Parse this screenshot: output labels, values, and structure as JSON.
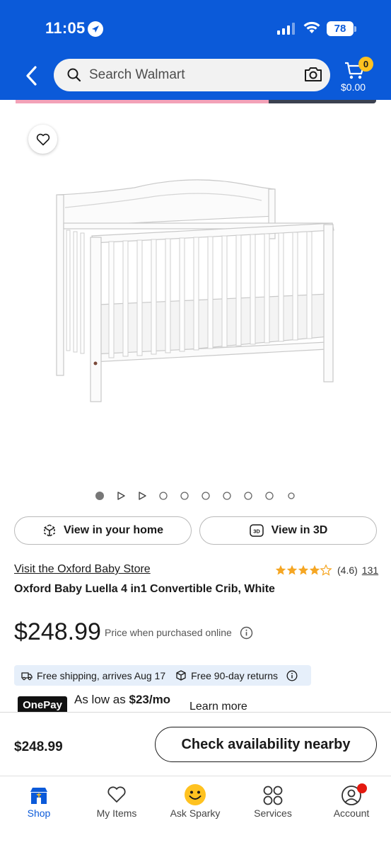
{
  "status_bar": {
    "time": "11:05",
    "battery": "78"
  },
  "header": {
    "search_placeholder": "Search Walmart",
    "cart_count": "0",
    "cart_total": "$0.00"
  },
  "gallery": {
    "image_count": 10,
    "active_index": 0
  },
  "actions": {
    "view_in_home": "View in your home",
    "view_in_3d": "View in 3D"
  },
  "product": {
    "store_link": "Visit the Oxford Baby Store",
    "rating": "(4.6)",
    "rating_value": 4.6,
    "review_count": "131",
    "title": "Oxford Baby Luella 4 in1 Convertible Crib, White",
    "price": "$248.99",
    "price_note": "Price when purchased online",
    "shipping": "Free shipping, arrives Aug 17",
    "returns": "Free 90-day returns"
  },
  "onepay": {
    "logo": "OnePay",
    "prefix": "As low as ",
    "amount": "$23/mo",
    "learn_more": "Learn more"
  },
  "sticky_bar": {
    "price": "$248.99",
    "button": "Check availability nearby"
  },
  "tabs": [
    {
      "label": "Shop",
      "active": true
    },
    {
      "label": "My Items"
    },
    {
      "label": "Ask Sparky"
    },
    {
      "label": "Services"
    },
    {
      "label": "Account"
    }
  ],
  "colors": {
    "brand_blue": "#0b5ad9",
    "spark_yellow": "#ffc220",
    "star_gold": "#f5a623",
    "notification_red": "#e4190f"
  }
}
